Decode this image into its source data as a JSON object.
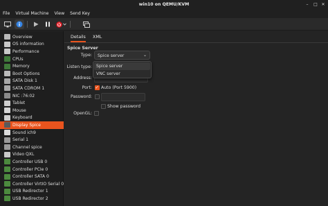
{
  "window": {
    "title": "win10 on QEMU/KVM"
  },
  "menubar": [
    "File",
    "Virtual Machine",
    "View",
    "Send Key"
  ],
  "toolbar": {
    "buttons": [
      "monitor-icon",
      "info-icon",
      "play-icon",
      "pause-icon",
      "power-icon",
      "chevron-down-icon",
      "screenshot-icon"
    ]
  },
  "sidebar": {
    "items": [
      {
        "label": "Overview",
        "icon": "overview-icon",
        "color": "#b9b9b9"
      },
      {
        "label": "OS information",
        "icon": "os-info-icon",
        "color": "#c9c9c9"
      },
      {
        "label": "Performance",
        "icon": "performance-icon",
        "color": "#c9c9c9"
      },
      {
        "label": "CPUs",
        "icon": "cpu-icon",
        "color": "#3f7a3a"
      },
      {
        "label": "Memory",
        "icon": "memory-icon",
        "color": "#3f7a3a"
      },
      {
        "label": "Boot Options",
        "icon": "boot-icon",
        "color": "#bbbbbb"
      },
      {
        "label": "SATA Disk 1",
        "icon": "disk-icon",
        "color": "#a7a7a7"
      },
      {
        "label": "SATA CDROM 1",
        "icon": "cdrom-icon",
        "color": "#a7a7a7"
      },
      {
        "label": "NIC :76:02",
        "icon": "network-icon",
        "color": "#8a8a8a"
      },
      {
        "label": "Tablet",
        "icon": "tablet-icon",
        "color": "#cfcfcf"
      },
      {
        "label": "Mouse",
        "icon": "mouse-icon",
        "color": "#d5d5d5"
      },
      {
        "label": "Keyboard",
        "icon": "keyboard-icon",
        "color": "#cfcfcf"
      },
      {
        "label": "Display Spice",
        "icon": "display-icon",
        "color": "#5a5a5a"
      },
      {
        "label": "Sound ich9",
        "icon": "sound-icon",
        "color": "#dcdcdc"
      },
      {
        "label": "Serial 1",
        "icon": "serial-icon",
        "color": "#9a9a9a"
      },
      {
        "label": "Channel spice",
        "icon": "channel-icon",
        "color": "#9a9a9a"
      },
      {
        "label": "Video QXL",
        "icon": "video-icon",
        "color": "#c9c9c9"
      },
      {
        "label": "Controller USB 0",
        "icon": "controller-icon",
        "color": "#4c8a3e"
      },
      {
        "label": "Controller PCIe 0",
        "icon": "controller-icon",
        "color": "#4c8a3e"
      },
      {
        "label": "Controller SATA 0",
        "icon": "controller-icon",
        "color": "#4c8a3e"
      },
      {
        "label": "Controller VirtIO Serial 0",
        "icon": "controller-icon",
        "color": "#4c8a3e"
      },
      {
        "label": "USB Redirector 1",
        "icon": "usb-icon",
        "color": "#4c8a3e"
      },
      {
        "label": "USB Redirector 2",
        "icon": "usb-icon",
        "color": "#4c8a3e"
      }
    ],
    "selected_index": 12
  },
  "tabs": [
    "Details",
    "XML"
  ],
  "active_tab": "Details",
  "spice": {
    "section_title": "Spice Server",
    "type_label": "Type:",
    "type_value": "Spice server",
    "type_options": [
      "Spice server",
      "VNC server"
    ],
    "listen_label": "Listen type:",
    "address_label": "Address:",
    "port_label": "Port:",
    "port_auto_label": "Auto (Port 5900)",
    "password_label": "Password:",
    "show_password_label": "Show password",
    "opengl_label": "OpenGL:"
  },
  "colors": {
    "accent": "#e9541e",
    "power": "#e01b24",
    "info": "#3584e4"
  }
}
